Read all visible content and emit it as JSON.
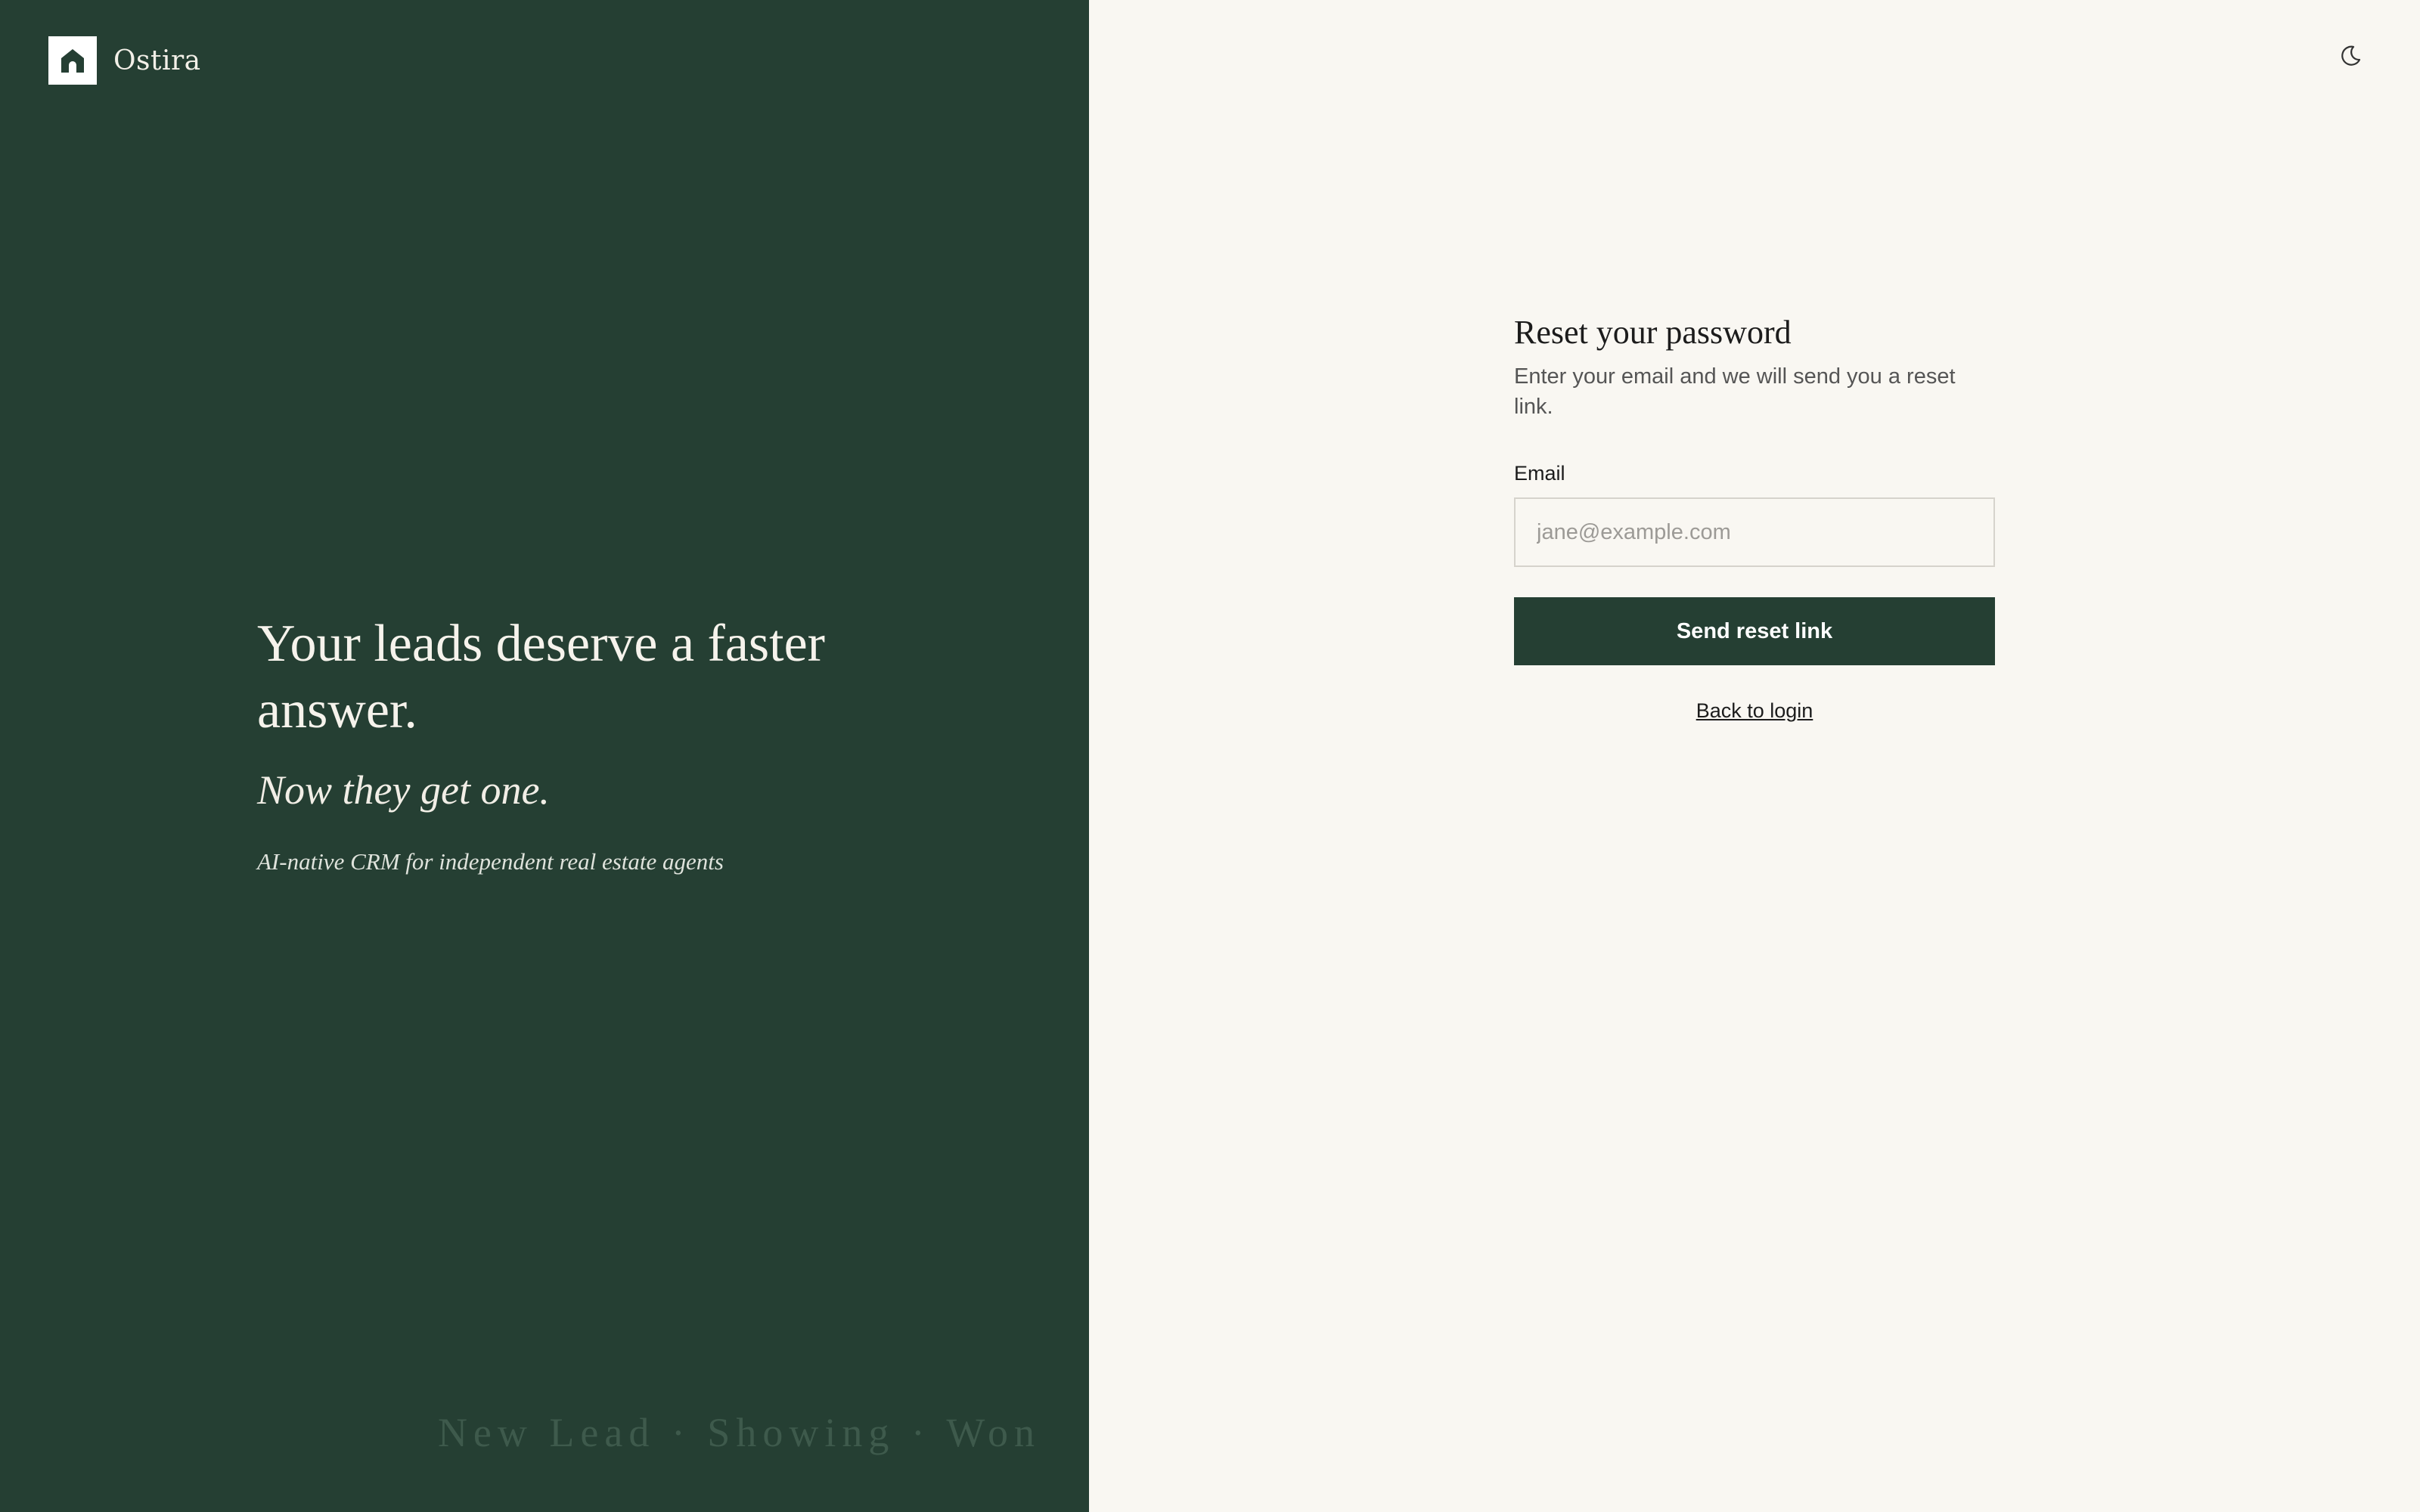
{
  "brand": {
    "name": "Ostira",
    "logo_icon": "house-icon"
  },
  "hero": {
    "title": "Your leads deserve a faster answer.",
    "subtitle": "Now they get one.",
    "tagline": "AI-native CRM for independent real estate agents"
  },
  "pipeline_text": "New Lead · Showing · Won",
  "theme_toggle": {
    "icon": "moon-icon"
  },
  "form": {
    "title": "Reset your password",
    "description": "Enter your email and we will send you a reset link.",
    "email_label": "Email",
    "email_placeholder": "jane@example.com",
    "email_value": "",
    "submit_label": "Send reset link",
    "back_link": "Back to login"
  },
  "colors": {
    "brand_green": "#253f33",
    "background": "#f9f7f2"
  }
}
